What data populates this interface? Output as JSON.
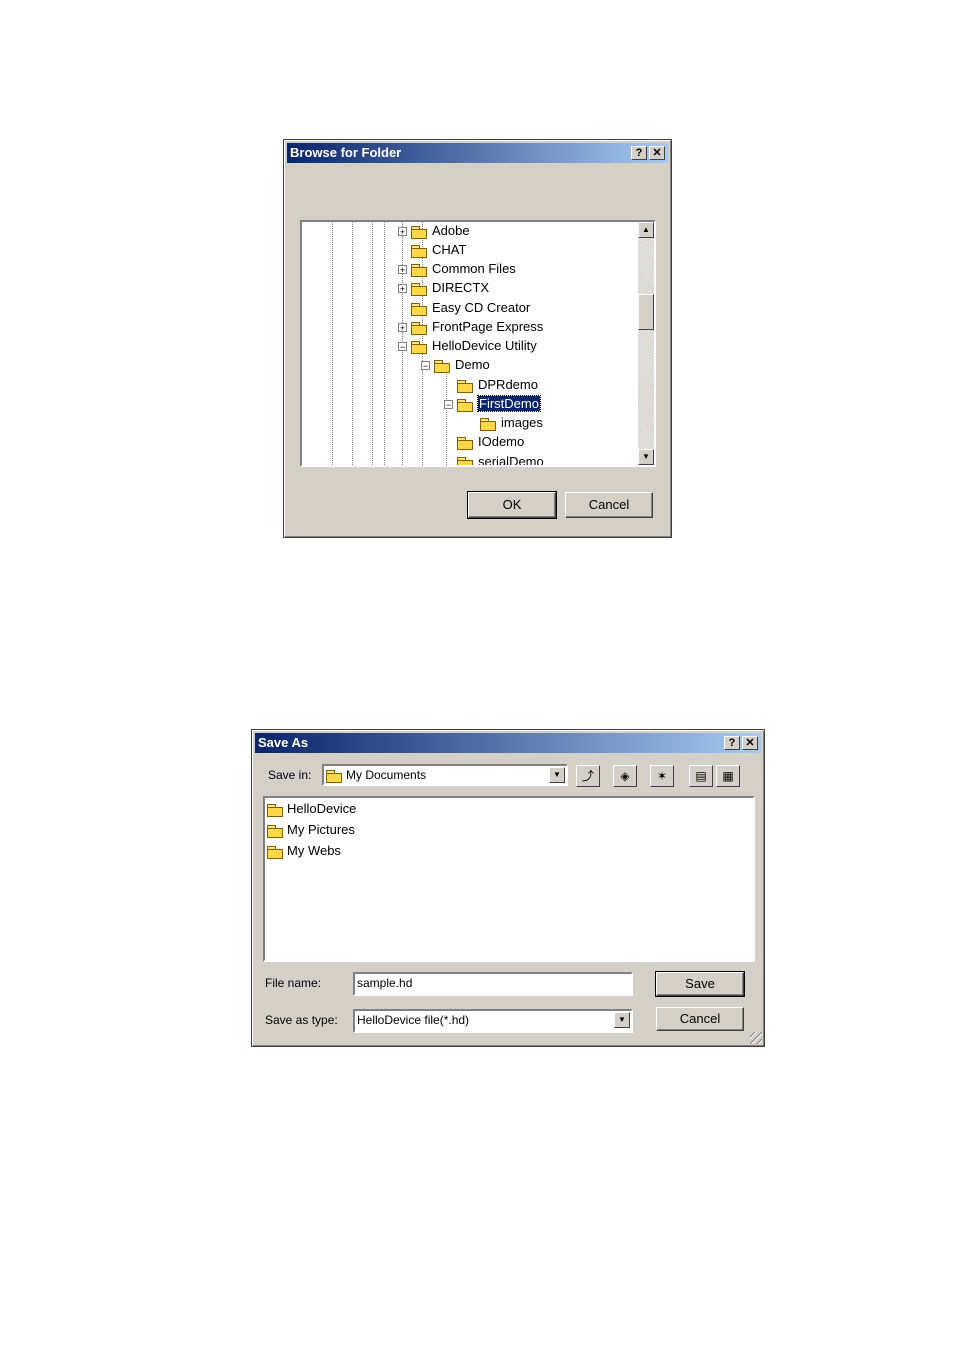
{
  "browse_dialog": {
    "title": "Browse for Folder",
    "help_button": "?",
    "close_button": "✕",
    "tree": [
      {
        "label": "Adobe",
        "expander": "+"
      },
      {
        "label": "CHAT",
        "expander": ""
      },
      {
        "label": "Common Files",
        "expander": "+"
      },
      {
        "label": "DIRECTX",
        "expander": "+"
      },
      {
        "label": "Easy CD Creator",
        "expander": ""
      },
      {
        "label": "FrontPage Express",
        "expander": "+"
      },
      {
        "label": "HelloDevice Utility",
        "expander": "−"
      },
      {
        "label": "Demo",
        "expander": "−"
      },
      {
        "label": "DPRdemo",
        "expander": ""
      },
      {
        "label": "FirstDemo",
        "expander": "−",
        "selected": true
      },
      {
        "label": "images",
        "expander": ""
      },
      {
        "label": "IOdemo",
        "expander": ""
      },
      {
        "label": "serialDemo",
        "expander": ""
      }
    ],
    "ok_label": "OK",
    "cancel_label": "Cancel"
  },
  "save_dialog": {
    "title": "Save As",
    "help_button": "?",
    "close_button": "✕",
    "save_in_label": "Save in:",
    "save_in_value": "My Documents",
    "files": [
      "HelloDevice",
      "My Pictures",
      "My Webs"
    ],
    "file_name_label": "File name:",
    "file_name_value": "sample.hd",
    "save_as_type_label": "Save as type:",
    "save_as_type_value": "HelloDevice file(*.hd)",
    "save_label": "Save",
    "cancel_label": "Cancel"
  },
  "colors": {
    "title_gradient_start": "#0a246a",
    "title_gradient_end": "#a6caf0",
    "dialog_face": "#d4d0c8",
    "folder_yellow": "#ffd84a"
  }
}
